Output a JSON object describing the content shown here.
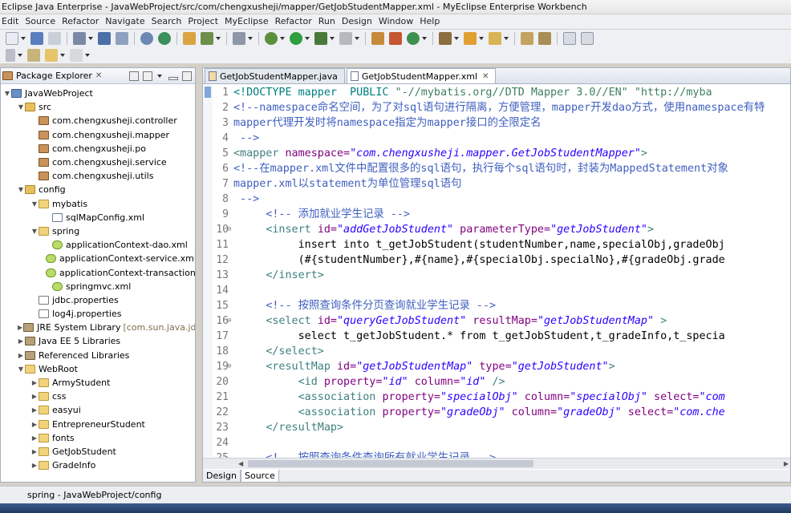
{
  "window": {
    "title": "Eclipse Java Enterprise - JavaWebProject/src/com/chengxusheji/mapper/GetJobStudentMapper.xml - MyEclipse Enterprise Workbench"
  },
  "menu": [
    "Edit",
    "Source",
    "Refactor",
    "Navigate",
    "Search",
    "Project",
    "MyEclipse",
    "Refactor",
    "Run",
    "Design",
    "Window",
    "Help"
  ],
  "package_explorer": {
    "title": "Package Explorer",
    "close_glyph": "✕",
    "tree": [
      {
        "indent": 0,
        "arrow": "▼",
        "icon": "project",
        "label": "JavaWebProject"
      },
      {
        "indent": 1,
        "arrow": "▼",
        "icon": "srcfolder",
        "label": "src"
      },
      {
        "indent": 2,
        "arrow": "",
        "icon": "package",
        "label": "com.chengxusheji.controller"
      },
      {
        "indent": 2,
        "arrow": "",
        "icon": "package",
        "label": "com.chengxusheji.mapper"
      },
      {
        "indent": 2,
        "arrow": "",
        "icon": "package",
        "label": "com.chengxusheji.po"
      },
      {
        "indent": 2,
        "arrow": "",
        "icon": "package",
        "label": "com.chengxusheji.service"
      },
      {
        "indent": 2,
        "arrow": "",
        "icon": "package",
        "label": "com.chengxusheji.utils"
      },
      {
        "indent": 1,
        "arrow": "▼",
        "icon": "srcfolder",
        "label": "config"
      },
      {
        "indent": 2,
        "arrow": "▼",
        "icon": "folder",
        "label": "mybatis"
      },
      {
        "indent": 3,
        "arrow": "",
        "icon": "xml",
        "label": "sqlMapConfig.xml"
      },
      {
        "indent": 2,
        "arrow": "▼",
        "icon": "folder",
        "label": "spring"
      },
      {
        "indent": 3,
        "arrow": "",
        "icon": "springxml",
        "label": "applicationContext-dao.xml"
      },
      {
        "indent": 3,
        "arrow": "",
        "icon": "springxml",
        "label": "applicationContext-service.xml"
      },
      {
        "indent": 3,
        "arrow": "",
        "icon": "springxml",
        "label": "applicationContext-transaction"
      },
      {
        "indent": 3,
        "arrow": "",
        "icon": "springxml",
        "label": "springmvc.xml"
      },
      {
        "indent": 2,
        "arrow": "",
        "icon": "props",
        "label": "jdbc.properties"
      },
      {
        "indent": 2,
        "arrow": "",
        "icon": "props",
        "label": "log4j.properties"
      },
      {
        "indent": 1,
        "arrow": "▶",
        "icon": "lib",
        "label": "JRE System Library",
        "extra": "[com.sun.java.jdk"
      },
      {
        "indent": 1,
        "arrow": "▶",
        "icon": "lib",
        "label": "Java EE 5 Libraries"
      },
      {
        "indent": 1,
        "arrow": "▶",
        "icon": "lib",
        "label": "Referenced Libraries"
      },
      {
        "indent": 1,
        "arrow": "▼",
        "icon": "folder",
        "label": "WebRoot"
      },
      {
        "indent": 2,
        "arrow": "▶",
        "icon": "folder",
        "label": "ArmyStudent"
      },
      {
        "indent": 2,
        "arrow": "▶",
        "icon": "folder",
        "label": "css"
      },
      {
        "indent": 2,
        "arrow": "▶",
        "icon": "folder",
        "label": "easyui"
      },
      {
        "indent": 2,
        "arrow": "▶",
        "icon": "folder",
        "label": "EntrepreneurStudent"
      },
      {
        "indent": 2,
        "arrow": "▶",
        "icon": "folder",
        "label": "fonts"
      },
      {
        "indent": 2,
        "arrow": "▶",
        "icon": "folder",
        "label": "GetJobStudent"
      },
      {
        "indent": 2,
        "arrow": "▶",
        "icon": "folder",
        "label": "GradeInfo"
      }
    ]
  },
  "editor": {
    "tabs": [
      {
        "label": "GetJobStudentMapper.java",
        "active": false,
        "icon": "java"
      },
      {
        "label": "GetJobStudentMapper.xml",
        "active": true,
        "icon": "xml",
        "close": "✕"
      }
    ],
    "lines": [
      {
        "n": "1",
        "fold": "",
        "parts": [
          {
            "c": "doc",
            "t": "<!DOCTYPE mapper  PUBLIC "
          },
          {
            "c": "docstr",
            "t": "\"-//mybatis.org//DTD Mapper 3.0//EN\""
          },
          {
            "c": "docstr",
            "t": " \"http://myba"
          }
        ]
      },
      {
        "n": "2",
        "fold": "",
        "parts": [
          {
            "c": "com",
            "t": "<!--namespace命名空间，为了对sql语句进行隔离，方便管理，mapper开发dao方式，使用namespace有特"
          }
        ]
      },
      {
        "n": "3",
        "fold": "",
        "parts": [
          {
            "c": "com",
            "t": "mapper代理开发时将namespace指定为mapper接口的全限定名"
          }
        ]
      },
      {
        "n": "4",
        "fold": "",
        "parts": [
          {
            "c": "com",
            "t": " -->"
          }
        ]
      },
      {
        "n": "5",
        "fold": "",
        "parts": [
          {
            "c": "tag",
            "t": "<mapper "
          },
          {
            "c": "attr",
            "t": "namespace="
          },
          {
            "c": "val",
            "t": "\"com.chengxusheji.mapper.GetJobStudentMapper\""
          },
          {
            "c": "tag",
            "t": ">"
          }
        ]
      },
      {
        "n": "6",
        "fold": "",
        "parts": [
          {
            "c": "com",
            "t": "<!--在mapper.xml文件中配置很多的sql语句，执行每个sql语句时，封装为MappedStatement对象"
          }
        ]
      },
      {
        "n": "7",
        "fold": "",
        "parts": [
          {
            "c": "com",
            "t": "mapper.xml以statement为单位管理sql语句"
          }
        ]
      },
      {
        "n": "8",
        "fold": "",
        "parts": [
          {
            "c": "com",
            "t": " -->"
          }
        ]
      },
      {
        "n": "9",
        "fold": "",
        "parts": [
          {
            "c": "com",
            "t": "     <!-- 添加就业学生记录 -->"
          }
        ]
      },
      {
        "n": "10",
        "fold": "⊖",
        "parts": [
          {
            "c": "text",
            "t": "     "
          },
          {
            "c": "tag",
            "t": "<insert "
          },
          {
            "c": "attr",
            "t": "id="
          },
          {
            "c": "val",
            "t": "\"addGetJobStudent\""
          },
          {
            "c": "attr",
            "t": " parameterType="
          },
          {
            "c": "val",
            "t": "\"getJobStudent\""
          },
          {
            "c": "tag",
            "t": ">"
          }
        ]
      },
      {
        "n": "11",
        "fold": "",
        "parts": [
          {
            "c": "text",
            "t": "          insert into t_getJobStudent(studentNumber,name,specialObj,gradeObj"
          }
        ]
      },
      {
        "n": "12",
        "fold": "",
        "parts": [
          {
            "c": "text",
            "t": "          (#{studentNumber},#{name},#{specialObj.specialNo},#{gradeObj.grade"
          }
        ]
      },
      {
        "n": "13",
        "fold": "",
        "parts": [
          {
            "c": "text",
            "t": "     "
          },
          {
            "c": "tag",
            "t": "</insert>"
          }
        ]
      },
      {
        "n": "14",
        "fold": "",
        "parts": []
      },
      {
        "n": "15",
        "fold": "",
        "parts": [
          {
            "c": "com",
            "t": "     <!-- 按照查询条件分页查询就业学生记录 -->"
          }
        ]
      },
      {
        "n": "16",
        "fold": "⊖",
        "parts": [
          {
            "c": "text",
            "t": "     "
          },
          {
            "c": "tag",
            "t": "<select "
          },
          {
            "c": "attr",
            "t": "id="
          },
          {
            "c": "val",
            "t": "\"queryGetJobStudent\""
          },
          {
            "c": "attr",
            "t": " resultMap="
          },
          {
            "c": "val",
            "t": "\"getJobStudentMap\""
          },
          {
            "c": "tag",
            "t": " >"
          }
        ]
      },
      {
        "n": "17",
        "fold": "",
        "parts": [
          {
            "c": "text",
            "t": "          select t_getJobStudent.* from t_getJobStudent,t_gradeInfo,t_specia"
          }
        ]
      },
      {
        "n": "18",
        "fold": "",
        "parts": [
          {
            "c": "text",
            "t": "     "
          },
          {
            "c": "tag",
            "t": "</select>"
          }
        ]
      },
      {
        "n": "19",
        "fold": "⊖",
        "parts": [
          {
            "c": "text",
            "t": "     "
          },
          {
            "c": "tag",
            "t": "<resultMap "
          },
          {
            "c": "attr",
            "t": "id="
          },
          {
            "c": "val",
            "t": "\"getJobStudentMap\""
          },
          {
            "c": "attr",
            "t": " type="
          },
          {
            "c": "val",
            "t": "\"getJobStudent\""
          },
          {
            "c": "tag",
            "t": ">"
          }
        ]
      },
      {
        "n": "20",
        "fold": "",
        "parts": [
          {
            "c": "text",
            "t": "          "
          },
          {
            "c": "tag",
            "t": "<id "
          },
          {
            "c": "attr",
            "t": "property="
          },
          {
            "c": "val",
            "t": "\"id\""
          },
          {
            "c": "attr",
            "t": " column="
          },
          {
            "c": "val",
            "t": "\"id\""
          },
          {
            "c": "tag",
            "t": " />"
          }
        ]
      },
      {
        "n": "21",
        "fold": "",
        "parts": [
          {
            "c": "text",
            "t": "          "
          },
          {
            "c": "tag",
            "t": "<association "
          },
          {
            "c": "attr",
            "t": "property="
          },
          {
            "c": "val",
            "t": "\"specialObj\""
          },
          {
            "c": "attr",
            "t": " column="
          },
          {
            "c": "val",
            "t": "\"specialObj\""
          },
          {
            "c": "attr",
            "t": " select="
          },
          {
            "c": "val",
            "t": "\"com"
          }
        ]
      },
      {
        "n": "22",
        "fold": "",
        "parts": [
          {
            "c": "text",
            "t": "          "
          },
          {
            "c": "tag",
            "t": "<association "
          },
          {
            "c": "attr",
            "t": "property="
          },
          {
            "c": "val",
            "t": "\"gradeObj\""
          },
          {
            "c": "attr",
            "t": " column="
          },
          {
            "c": "val",
            "t": "\"gradeObj\""
          },
          {
            "c": "attr",
            "t": " select="
          },
          {
            "c": "val",
            "t": "\"com.che"
          }
        ]
      },
      {
        "n": "23",
        "fold": "",
        "parts": [
          {
            "c": "text",
            "t": "     "
          },
          {
            "c": "tag",
            "t": "</resultMap>"
          }
        ]
      },
      {
        "n": "24",
        "fold": "",
        "parts": []
      },
      {
        "n": "25",
        "fold": "",
        "parts": [
          {
            "c": "com",
            "t": "     <!-- 按照查询条件查询所有就业学生记录 -->"
          }
        ]
      }
    ],
    "bottom_tabs": [
      {
        "label": "Design",
        "active": false
      },
      {
        "label": "Source",
        "active": true
      }
    ]
  },
  "statusbar": {
    "text": "spring - JavaWebProject/config"
  }
}
